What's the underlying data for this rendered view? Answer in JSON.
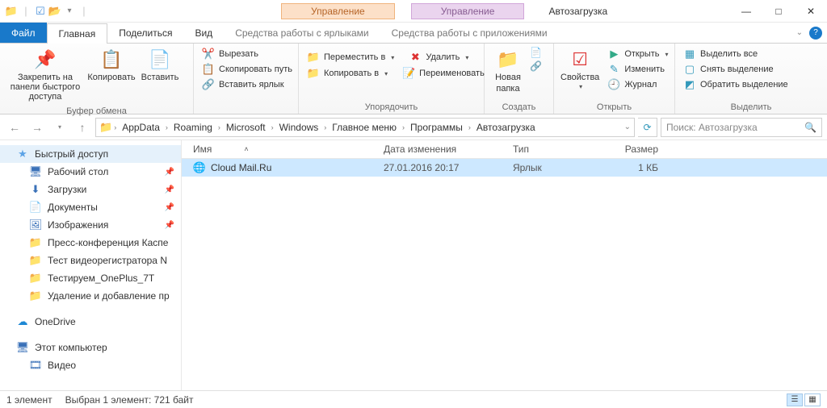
{
  "window": {
    "title": "Автозагрузка"
  },
  "context_tabs": {
    "left": {
      "title": "Управление",
      "sub": "Средства работы с ярлыками"
    },
    "right": {
      "title": "Управление",
      "sub": "Средства работы с приложениями"
    }
  },
  "tabs": {
    "file": "Файл",
    "home": "Главная",
    "share": "Поделиться",
    "view": "Вид"
  },
  "ribbon": {
    "clipboard": {
      "title": "Буфер обмена",
      "pin": "Закрепить на панели быстрого доступа",
      "copy": "Копировать",
      "paste": "Вставить",
      "cut": "Вырезать",
      "copypath": "Скопировать путь",
      "pasteshortcut": "Вставить ярлык"
    },
    "organize": {
      "title": "Упорядочить",
      "moveto": "Переместить в",
      "copyto": "Копировать в",
      "delete": "Удалить",
      "rename": "Переименовать"
    },
    "new": {
      "title": "Создать",
      "newfolder1": "Новая",
      "newfolder2": "папка"
    },
    "open": {
      "title": "Открыть",
      "properties": "Свойства",
      "open": "Открыть",
      "edit": "Изменить",
      "history": "Журнал"
    },
    "select": {
      "title": "Выделить",
      "all": "Выделить все",
      "none": "Снять выделение",
      "invert": "Обратить выделение"
    }
  },
  "breadcrumb": [
    "AppData",
    "Roaming",
    "Microsoft",
    "Windows",
    "Главное меню",
    "Программы",
    "Автозагрузка"
  ],
  "search": {
    "placeholder": "Поиск: Автозагрузка"
  },
  "columns": {
    "name": "Имя",
    "date": "Дата изменения",
    "type": "Тип",
    "size": "Размер"
  },
  "files": [
    {
      "name": "Cloud Mail.Ru",
      "date": "27.01.2016 20:17",
      "type": "Ярлык",
      "size": "1 КБ"
    }
  ],
  "nav": {
    "quick": "Быстрый доступ",
    "desktop": "Рабочий стол",
    "downloads": "Загрузки",
    "documents": "Документы",
    "pictures": "Изображения",
    "f1": "Пресс-конференция Каспе",
    "f2": "Тест видеорегистратора N",
    "f3": "Тестируем_OnePlus_7T",
    "f4": "Удаление и добавление пр",
    "onedrive": "OneDrive",
    "thispc": "Этот компьютер",
    "videos": "Видео"
  },
  "status": {
    "count": "1 элемент",
    "selected": "Выбран 1 элемент: 721 байт"
  }
}
